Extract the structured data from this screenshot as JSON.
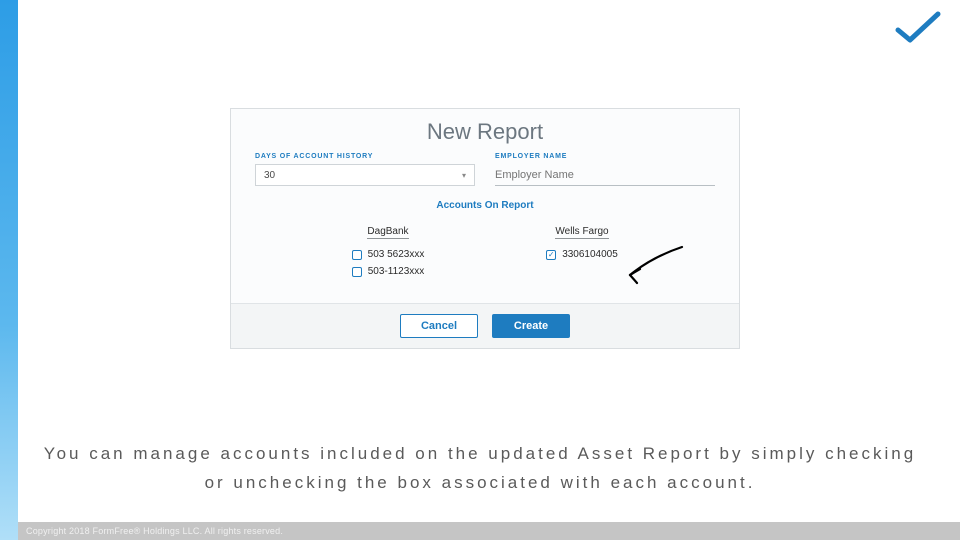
{
  "modal": {
    "title": "New Report",
    "days_label": "DAYS OF ACCOUNT HISTORY",
    "days_value": "30",
    "employer_label": "EMPLOYER NAME",
    "employer_placeholder": "Employer Name",
    "section_title": "Accounts On Report",
    "banks": [
      {
        "name": "DagBank",
        "accounts": [
          {
            "label": "503 5623xxx",
            "checked": false
          },
          {
            "label": "503-1123xxx",
            "checked": false
          }
        ]
      },
      {
        "name": "Wells Fargo",
        "accounts": [
          {
            "label": "3306104005",
            "checked": true
          }
        ]
      }
    ],
    "cancel_label": "Cancel",
    "create_label": "Create"
  },
  "caption": "You can manage accounts included on the updated Asset Report by simply checking or unchecking the box associated with each account.",
  "footer": "Copyright 2018 FormFree® Holdings LLC. All rights reserved."
}
